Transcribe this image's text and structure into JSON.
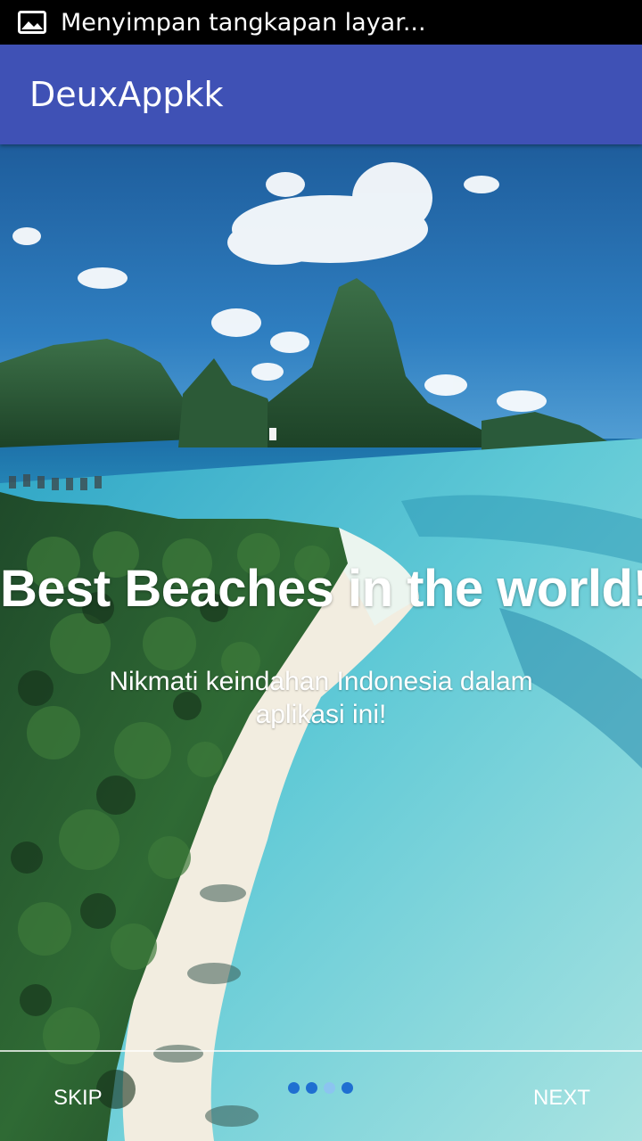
{
  "status_bar": {
    "notification_icon": "image-icon",
    "text": "Menyimpan tangkapan layar..."
  },
  "app_bar": {
    "title": "DeuxAppkk",
    "color": "#3f51b5"
  },
  "slide": {
    "image": "beach-island-photo",
    "title": "Best Beaches in the world!",
    "description": "Nikmati keindahan Indonesia dalam aplikasi ini!"
  },
  "bottom_nav": {
    "skip_label": "SKIP",
    "next_label": "NEXT",
    "dots": [
      {
        "active": true,
        "color": "#1f6fd1"
      },
      {
        "active": true,
        "color": "#1f6fd1"
      },
      {
        "active": false,
        "color": "#8cc4f0"
      },
      {
        "active": true,
        "color": "#1f6fd1"
      }
    ]
  }
}
